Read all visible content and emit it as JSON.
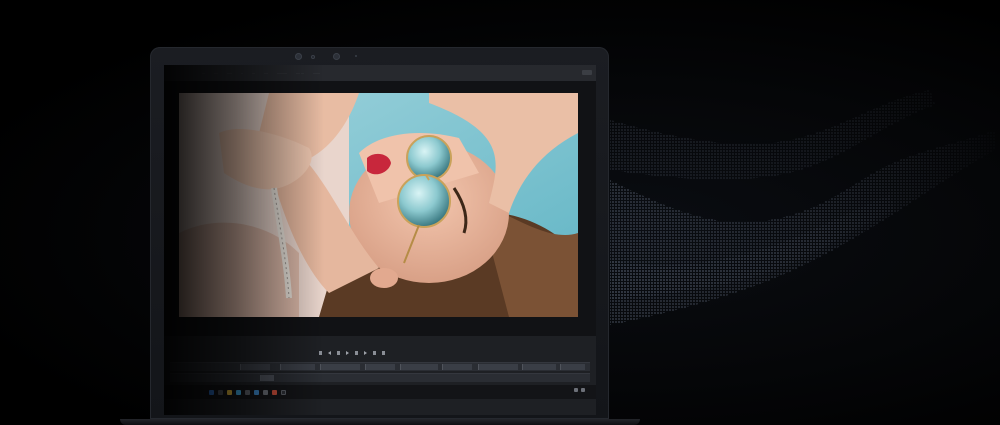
{
  "app": {
    "menu": [
      "···",
      "····",
      "·····",
      "··",
      "···",
      "····",
      "··········",
      "···· ···",
      "·······"
    ]
  },
  "timeline": {
    "timecode": "",
    "ticks": [
      "",
      "",
      "",
      "",
      "",
      "",
      "",
      "",
      "",
      "",
      "",
      ""
    ],
    "clip_labels": [
      "",
      "",
      "",
      "",
      "",
      "",
      "",
      "",
      "",
      "",
      "",
      "",
      "",
      ""
    ]
  },
  "taskbar": {
    "tray_text": "",
    "clock": ""
  },
  "brand": "",
  "colors": {
    "background": "#000000",
    "lid": "#1b1d22",
    "screen": "#1c1d21",
    "wave": "#bcd6ff"
  },
  "icons": [
    "camera-icon",
    "play-icon",
    "rewind-icon",
    "forward-icon",
    "stop-icon",
    "windows-icon",
    "wifi-icon",
    "volume-icon"
  ]
}
